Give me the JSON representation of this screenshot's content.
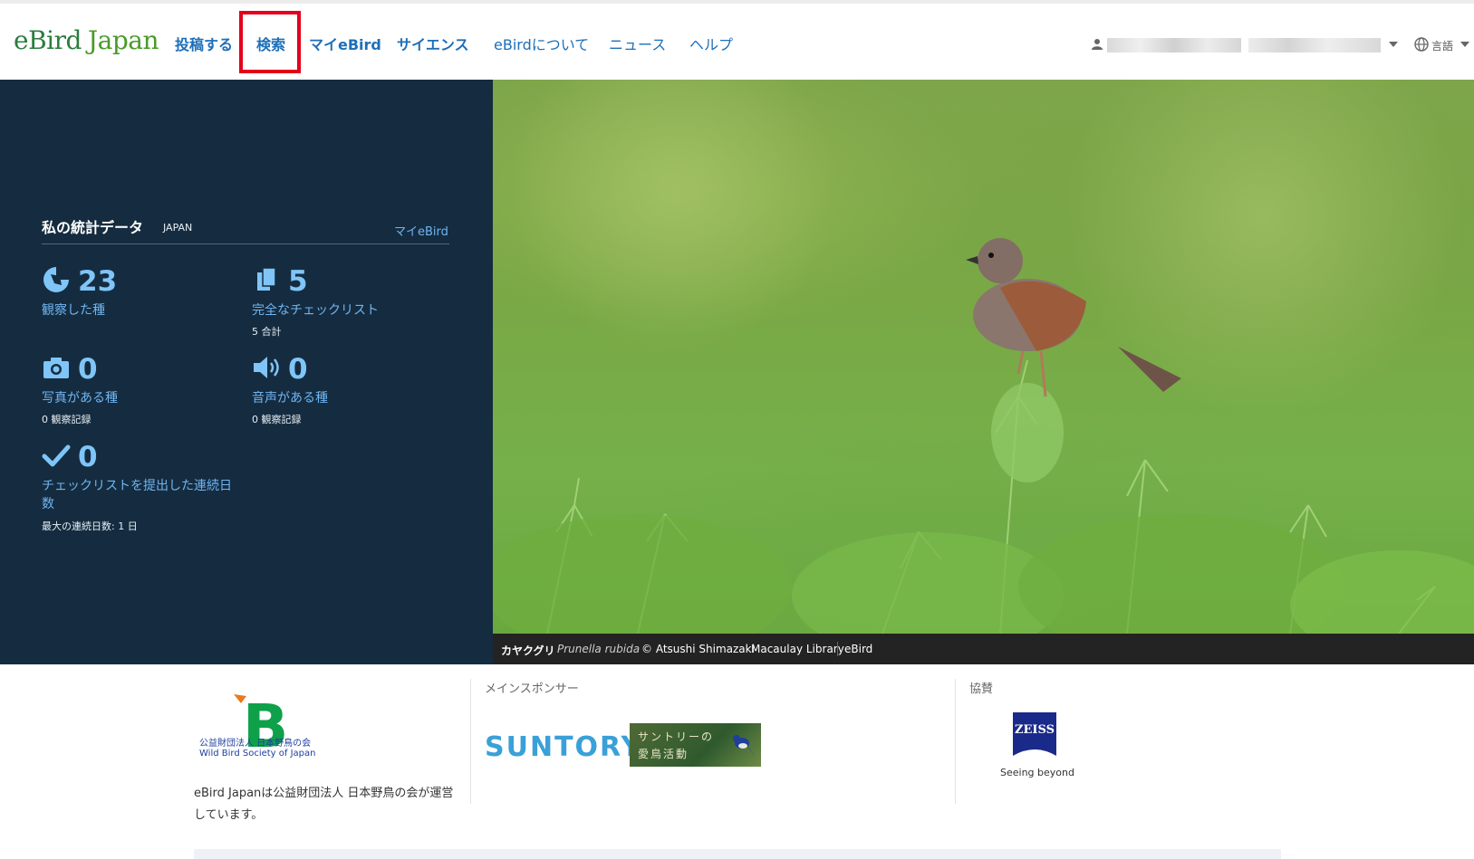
{
  "header": {
    "logo_part1": "eBird",
    "logo_part2": "Japan",
    "nav": [
      {
        "label": "投稿する"
      },
      {
        "label": "検索"
      },
      {
        "label": "マイeBird"
      },
      {
        "label": "サイエンス"
      },
      {
        "label": "eBirdについて"
      },
      {
        "label": "ニュース"
      },
      {
        "label": "ヘルプ"
      }
    ],
    "language_label": "言語",
    "highlight_color": "#e4001b"
  },
  "stats": {
    "title": "私の統計データ",
    "region": "JAPAN",
    "link": "マイeBird",
    "items": [
      {
        "icon": "species-icon",
        "value": "23",
        "label": "観察した種",
        "sub": ""
      },
      {
        "icon": "checklist-icon",
        "value": "5",
        "label": "完全なチェックリスト",
        "sub": "5 合計"
      },
      {
        "icon": "camera-icon",
        "value": "0",
        "label": "写真がある種",
        "sub": "0 観察記録"
      },
      {
        "icon": "speaker-icon",
        "value": "0",
        "label": "音声がある種",
        "sub": "0 観察記録"
      },
      {
        "icon": "checkmark-icon",
        "value": "0",
        "label": "チェックリストを提出した連続日数",
        "sub": "最大の連続日数: 1 日"
      }
    ]
  },
  "photo": {
    "common_name": "カヤクグリ",
    "scientific_name": "Prunella rubida",
    "credit": "© Atsushi Shimazaki",
    "library": "Macaulay Library",
    "source": "eBird"
  },
  "footer": {
    "wbsj_line1": "公益財団法人 日本野鳥の会",
    "wbsj_line2": "Wild Bird Society of Japan",
    "wbsj_mark": "B",
    "operated_text": "eBird Japanは公益財団法人 日本野鳥の会が運営しています。",
    "main_sponsor_heading": "メインスポンサー",
    "suntory": "SUNTORY",
    "aicho_line1": "サントリーの",
    "aicho_line2": "愛鳥活動",
    "supporter_heading": "協賛",
    "zeiss": "ZEISS",
    "zeiss_tagline": "Seeing beyond"
  }
}
